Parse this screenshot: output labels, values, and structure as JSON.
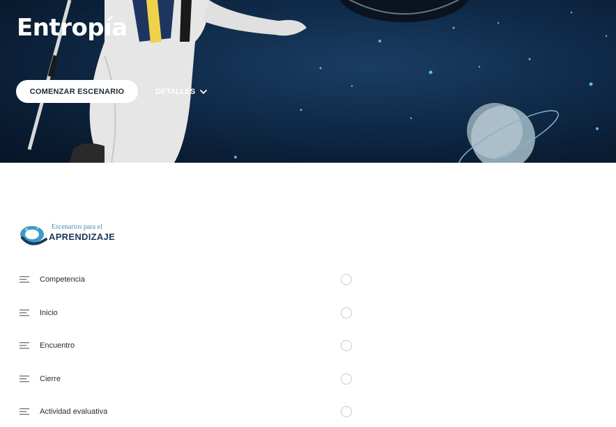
{
  "hero": {
    "title": "Entropía",
    "start_label": "COMENZAR ESCENARIO",
    "details_label": "DETALLES"
  },
  "logo": {
    "line1": "Escenarios para el",
    "line2": "APRENDIZAJE"
  },
  "menu": {
    "items": [
      {
        "label": "Competencia"
      },
      {
        "label": "Inicio"
      },
      {
        "label": "Encuentro"
      },
      {
        "label": "Cierre"
      },
      {
        "label": "Actividad evaluativa"
      }
    ]
  },
  "colors": {
    "hero_bg": "#0f2a48",
    "text": "#1d2a36",
    "logo_blue": "#1b3a5c",
    "logo_light": "#4a8fb0"
  }
}
